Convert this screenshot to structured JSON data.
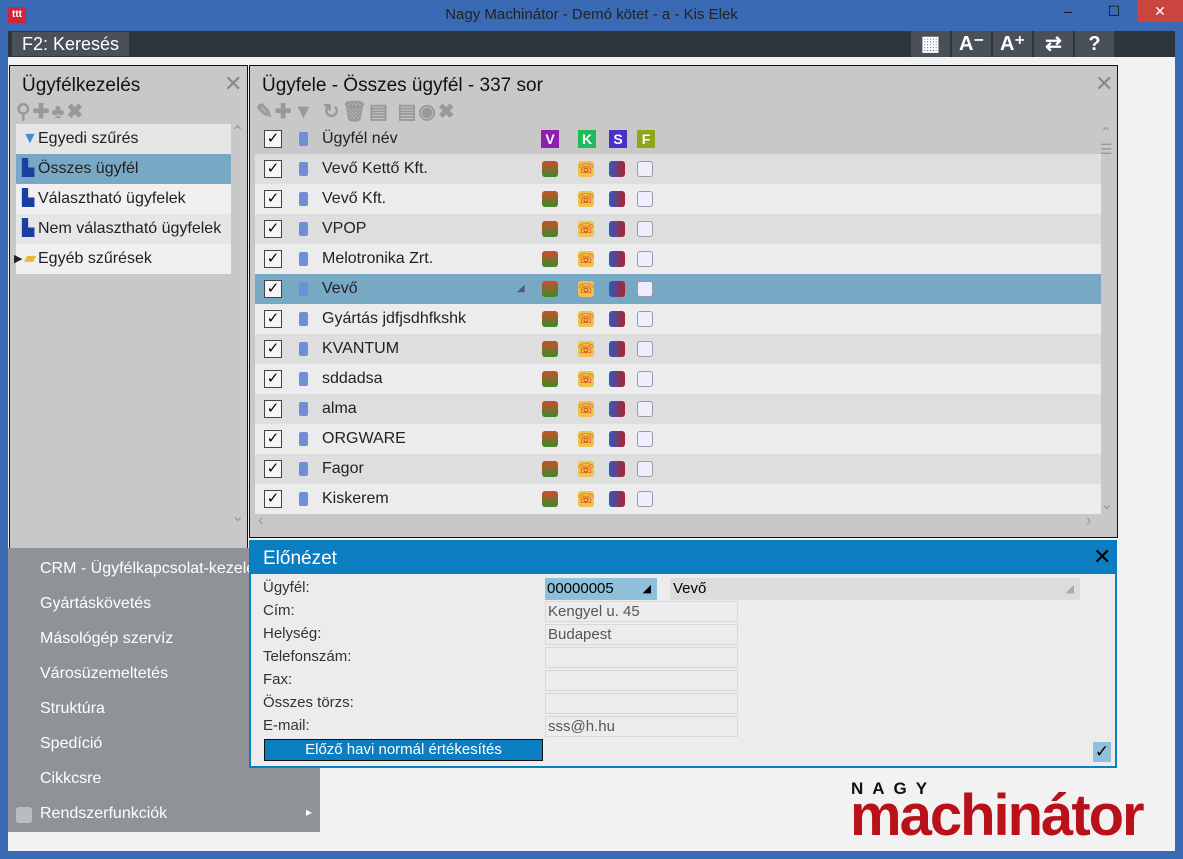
{
  "window": {
    "title": "Nagy Machinátor - Demó kötet - a - Kis Elek",
    "minimize": "–",
    "maximize": "☐",
    "close": "✕"
  },
  "toolbar": {
    "search": "F2: Keresés",
    "buttons": [
      {
        "icon": "grid-icon",
        "label": "▦"
      },
      {
        "icon": "font-decrease-icon",
        "label": "A⁻"
      },
      {
        "icon": "font-increase-icon",
        "label": "A⁺"
      },
      {
        "icon": "swap-icon",
        "label": "⇄"
      },
      {
        "icon": "help-icon",
        "label": "?"
      }
    ]
  },
  "left_panel": {
    "title": "Ügyfélkezelés",
    "close": "✕",
    "tools": "⚲✚♣✖",
    "items": [
      {
        "label": "Egyedi szűrés",
        "icon": "funnel-icon"
      },
      {
        "label": "Összes ügyfél",
        "icon": "computer-icon",
        "selected": true
      },
      {
        "label": "Választható ügyfelek",
        "icon": "computer-icon"
      },
      {
        "label": "Nem választható ügyfelek",
        "icon": "computer-icon"
      },
      {
        "label": "Egyéb szűrések",
        "icon": "folder-icon"
      }
    ]
  },
  "main_panel": {
    "title": "Ügyfele - Összes ügyfél - 337 sor",
    "close": "✕",
    "tools": "✎✚▼ ↻🗑▤ ▤◉✖",
    "header": {
      "name": "Ügyfél név",
      "badges": [
        {
          "label": "V",
          "color": "#8e1fb0"
        },
        {
          "label": "K",
          "color": "#1fbd5a"
        },
        {
          "label": "S",
          "color": "#4b2fc9"
        },
        {
          "label": "F",
          "color": "#8fa61c"
        }
      ]
    },
    "rows": [
      "Vevő Kettő Kft.",
      "Vevő Kft.",
      "VPOP",
      "Melotronika Zrt.",
      "Vevő",
      "Gyártás jdfjsdhfkshk",
      "KVANTUM",
      "sddadsa",
      "alma",
      "ORGWARE",
      "Fagor",
      "Kiskerem"
    ],
    "selected_row": 4
  },
  "preview": {
    "title": "Előnézet",
    "close": "✕",
    "labels": [
      "Ügyfél:",
      "Cím:",
      "Helység:",
      "Telefonszám:",
      "Fax:",
      "Összes törzs:",
      "E-mail:"
    ],
    "code": "00000005",
    "name": "Vevő",
    "values": [
      "Kengyel u. 45",
      "Budapest",
      "",
      "",
      "",
      "sss@h.hu"
    ],
    "button": "Előző havi normál értékesítés",
    "check": "✓"
  },
  "menu": {
    "items": [
      "CRM - Ügyfélkapcsolat-kezelés",
      "Gyártáskövetés",
      "Másológép szervíz",
      "Városüzemeltetés",
      "Struktúra",
      "Spedíció",
      "Cikkcsre",
      "Rendszerfunkciók"
    ],
    "arrow": "▸"
  },
  "logo": {
    "top": "NAGY",
    "bottom": "machinátor"
  }
}
